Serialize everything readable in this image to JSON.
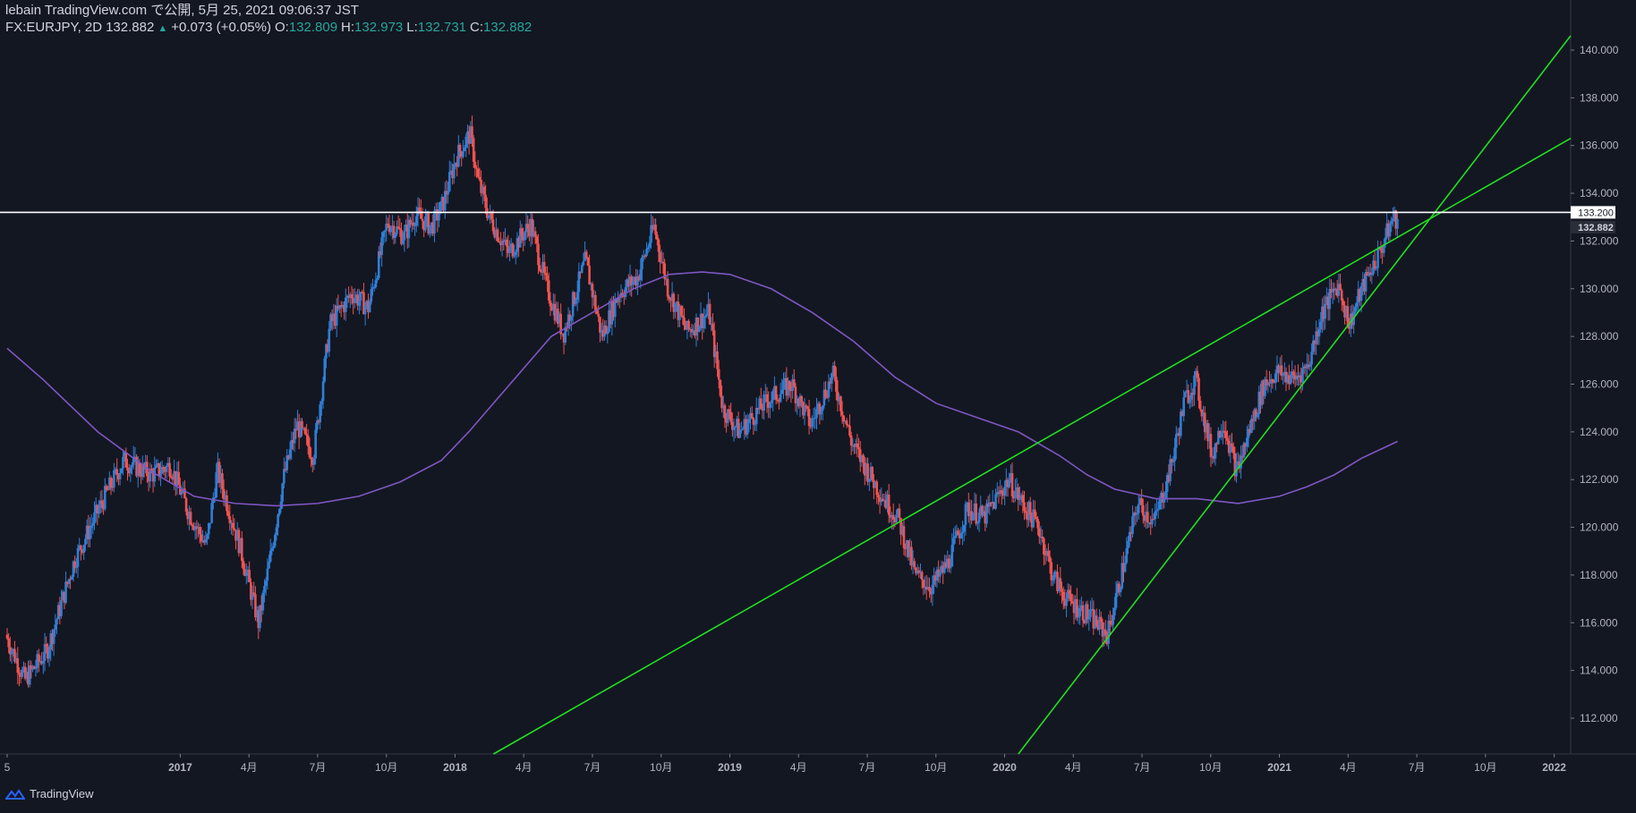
{
  "header": {
    "publisher": "lebain TradingView.com で公開, 5月 25, 2021 09:06:37 JST",
    "symbol": "FX:EURJPY, 2D",
    "last": "132.882",
    "change": "+0.073 (+0.05%)",
    "o_label": "O:",
    "o_value": "132.809",
    "h_label": "H:",
    "h_value": "132.973",
    "l_label": "L:",
    "l_value": "132.731",
    "c_label": "C:",
    "c_value": "132.882"
  },
  "footer": {
    "brand": "TradingView"
  },
  "colors": {
    "background": "#131722",
    "up": "#2f7fd6",
    "down": "#ef5350",
    "ma": "#7e57c2",
    "trendline": "#20e020",
    "hline": "#ffffff"
  },
  "chart_data": {
    "type": "candlestick",
    "symbol": "FX:EURJPY",
    "interval": "2D",
    "y_range": [
      110.5,
      140.6
    ],
    "y_ticks": [
      112,
      114,
      116,
      118,
      120,
      122,
      124,
      126,
      128,
      130,
      132,
      134,
      136,
      138,
      140
    ],
    "y_tick_labels": [
      "112.000",
      "114.000",
      "116.000",
      "118.000",
      "120.000",
      "122.000",
      "124.000",
      "126.000",
      "128.000",
      "130.000",
      "132.000",
      "134.000",
      "136.000",
      "138.000",
      "140.000"
    ],
    "x_ticks": [
      {
        "t": 2016.37,
        "label": "5"
      },
      {
        "t": 2017.0,
        "label": "2017"
      },
      {
        "t": 2017.25,
        "label": "4月"
      },
      {
        "t": 2017.5,
        "label": "7月"
      },
      {
        "t": 2017.75,
        "label": "10月"
      },
      {
        "t": 2018.0,
        "label": "2018"
      },
      {
        "t": 2018.25,
        "label": "4月"
      },
      {
        "t": 2018.5,
        "label": "7月"
      },
      {
        "t": 2018.75,
        "label": "10月"
      },
      {
        "t": 2019.0,
        "label": "2019"
      },
      {
        "t": 2019.25,
        "label": "4月"
      },
      {
        "t": 2019.5,
        "label": "7月"
      },
      {
        "t": 2019.75,
        "label": "10月"
      },
      {
        "t": 2020.0,
        "label": "2020"
      },
      {
        "t": 2020.25,
        "label": "4月"
      },
      {
        "t": 2020.5,
        "label": "7月"
      },
      {
        "t": 2020.75,
        "label": "10月"
      },
      {
        "t": 2021.0,
        "label": "2021"
      },
      {
        "t": 2021.25,
        "label": "4月"
      },
      {
        "t": 2021.5,
        "label": "7月"
      },
      {
        "t": 2021.75,
        "label": "10月"
      },
      {
        "t": 2022.0,
        "label": "2022"
      }
    ],
    "price_keypoints": [
      [
        2016.37,
        115.5
      ],
      [
        2016.44,
        113.6
      ],
      [
        2016.52,
        114.8
      ],
      [
        2016.62,
        118.6
      ],
      [
        2016.74,
        121.5
      ],
      [
        2016.8,
        122.8
      ],
      [
        2016.9,
        122.2
      ],
      [
        2016.97,
        122.6
      ],
      [
        2017.03,
        120.8
      ],
      [
        2017.1,
        119.2
      ],
      [
        2017.14,
        122.4
      ],
      [
        2017.22,
        119.3
      ],
      [
        2017.29,
        116.0
      ],
      [
        2017.33,
        118.5
      ],
      [
        2017.38,
        122.0
      ],
      [
        2017.43,
        124.3
      ],
      [
        2017.49,
        123.0
      ],
      [
        2017.55,
        128.5
      ],
      [
        2017.63,
        129.8
      ],
      [
        2017.69,
        129.2
      ],
      [
        2017.76,
        132.8
      ],
      [
        2017.82,
        132.2
      ],
      [
        2017.86,
        133.1
      ],
      [
        2017.92,
        132.6
      ],
      [
        2017.96,
        133.5
      ],
      [
        2018.01,
        135.5
      ],
      [
        2018.06,
        136.5
      ],
      [
        2018.09,
        134.5
      ],
      [
        2018.13,
        133.0
      ],
      [
        2018.2,
        131.5
      ],
      [
        2018.28,
        132.7
      ],
      [
        2018.34,
        130.0
      ],
      [
        2018.4,
        128.1
      ],
      [
        2018.48,
        131.2
      ],
      [
        2018.54,
        128.0
      ],
      [
        2018.6,
        129.8
      ],
      [
        2018.67,
        130.5
      ],
      [
        2018.73,
        132.6
      ],
      [
        2018.78,
        130.0
      ],
      [
        2018.85,
        128.2
      ],
      [
        2018.93,
        129.0
      ],
      [
        2018.98,
        125.0
      ],
      [
        2019.04,
        124.0
      ],
      [
        2019.14,
        125.3
      ],
      [
        2019.23,
        126.0
      ],
      [
        2019.3,
        124.3
      ],
      [
        2019.38,
        126.4
      ],
      [
        2019.45,
        123.5
      ],
      [
        2019.55,
        121.5
      ],
      [
        2019.62,
        120.3
      ],
      [
        2019.68,
        118.0
      ],
      [
        2019.74,
        117.5
      ],
      [
        2019.8,
        118.5
      ],
      [
        2019.87,
        120.8
      ],
      [
        2019.93,
        120.4
      ],
      [
        2020.02,
        122.0
      ],
      [
        2020.07,
        121.0
      ],
      [
        2020.13,
        120.0
      ],
      [
        2020.18,
        118.0
      ],
      [
        2020.23,
        117.0
      ],
      [
        2020.31,
        116.3
      ],
      [
        2020.38,
        115.5
      ],
      [
        2020.44,
        118.5
      ],
      [
        2020.49,
        121.0
      ],
      [
        2020.55,
        120.2
      ],
      [
        2020.61,
        122.5
      ],
      [
        2020.66,
        125.3
      ],
      [
        2020.7,
        126.2
      ],
      [
        2020.76,
        123.0
      ],
      [
        2020.8,
        124.5
      ],
      [
        2020.85,
        122.3
      ],
      [
        2020.9,
        124.2
      ],
      [
        2020.95,
        126.0
      ],
      [
        2021.0,
        126.5
      ],
      [
        2021.06,
        126.2
      ],
      [
        2021.11,
        126.8
      ],
      [
        2021.16,
        129.0
      ],
      [
        2021.22,
        130.2
      ],
      [
        2021.26,
        128.5
      ],
      [
        2021.3,
        129.8
      ],
      [
        2021.33,
        130.6
      ],
      [
        2021.37,
        131.5
      ],
      [
        2021.42,
        133.0
      ],
      [
        2021.43,
        132.9
      ]
    ],
    "moving_average": [
      [
        2016.37,
        127.5
      ],
      [
        2016.5,
        126.2
      ],
      [
        2016.7,
        124.0
      ],
      [
        2016.9,
        122.3
      ],
      [
        2017.05,
        121.3
      ],
      [
        2017.2,
        121.0
      ],
      [
        2017.35,
        120.9
      ],
      [
        2017.5,
        121.0
      ],
      [
        2017.65,
        121.3
      ],
      [
        2017.8,
        121.9
      ],
      [
        2017.95,
        122.8
      ],
      [
        2018.05,
        124.0
      ],
      [
        2018.2,
        126.0
      ],
      [
        2018.35,
        128.0
      ],
      [
        2018.5,
        129.0
      ],
      [
        2018.65,
        130.0
      ],
      [
        2018.78,
        130.6
      ],
      [
        2018.9,
        130.7
      ],
      [
        2019.0,
        130.6
      ],
      [
        2019.15,
        130.0
      ],
      [
        2019.3,
        129.0
      ],
      [
        2019.45,
        127.8
      ],
      [
        2019.6,
        126.3
      ],
      [
        2019.75,
        125.2
      ],
      [
        2019.9,
        124.6
      ],
      [
        2020.05,
        124.0
      ],
      [
        2020.2,
        123.0
      ],
      [
        2020.3,
        122.2
      ],
      [
        2020.4,
        121.6
      ],
      [
        2020.55,
        121.2
      ],
      [
        2020.7,
        121.2
      ],
      [
        2020.85,
        121.0
      ],
      [
        2021.0,
        121.3
      ],
      [
        2021.1,
        121.7
      ],
      [
        2021.2,
        122.2
      ],
      [
        2021.3,
        122.9
      ],
      [
        2021.43,
        123.6
      ]
    ],
    "horizontal_line": {
      "price": 133.2,
      "label": "133.200"
    },
    "last_price_label": {
      "price": 132.882,
      "label": "132.882"
    },
    "trendlines": [
      {
        "from": [
          2018.14,
          110.5
        ],
        "to": [
          2022.06,
          136.3
        ]
      },
      {
        "from": [
          2020.05,
          110.5
        ],
        "to": [
          2022.06,
          140.6
        ]
      }
    ]
  }
}
